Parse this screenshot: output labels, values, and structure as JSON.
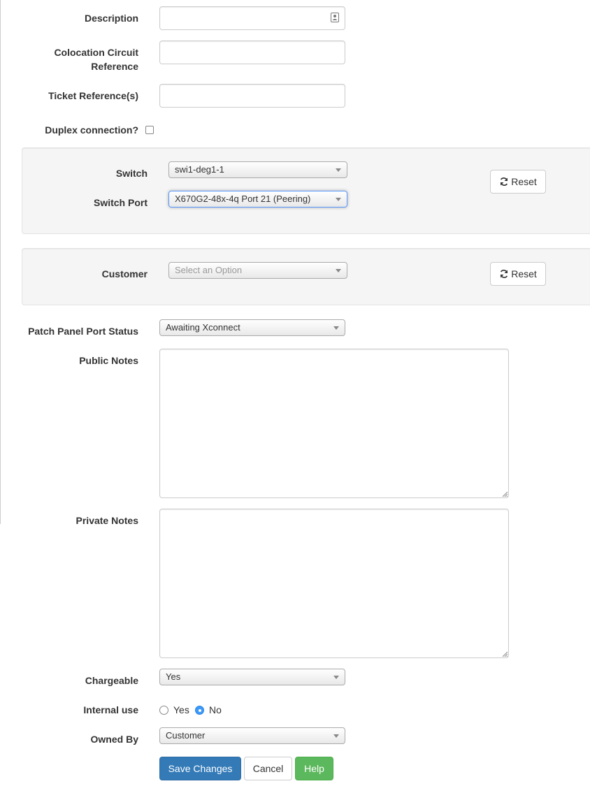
{
  "fields": {
    "description": {
      "label": "Description",
      "value": ""
    },
    "colocation": {
      "label_line1": "Colocation Circuit",
      "label_line2": "Reference",
      "value": ""
    },
    "ticket": {
      "label": "Ticket Reference(s)",
      "value": ""
    },
    "duplex": {
      "label": "Duplex connection?",
      "checked": false
    }
  },
  "switch_panel": {
    "switch_label": "Switch",
    "switch_value": "swi1-deg1-1",
    "port_label": "Switch Port",
    "port_value": "X670G2-48x-4q Port 21 (Peering)",
    "reset_label": "Reset"
  },
  "customer_panel": {
    "label": "Customer",
    "placeholder": "Select an Option",
    "reset_label": "Reset"
  },
  "status": {
    "label": "Patch Panel Port Status",
    "value": "Awaiting Xconnect"
  },
  "public_notes": {
    "label": "Public Notes",
    "value": ""
  },
  "private_notes": {
    "label": "Private Notes",
    "value": ""
  },
  "chargeable": {
    "label": "Chargeable",
    "value": "Yes"
  },
  "internal_use": {
    "label": "Internal use",
    "option_yes": "Yes",
    "option_no": "No",
    "selected": "No"
  },
  "owned_by": {
    "label": "Owned By",
    "value": "Customer"
  },
  "actions": {
    "save": "Save Changes",
    "cancel": "Cancel",
    "help": "Help"
  },
  "icons": {
    "reset": "refresh-icon",
    "description_field": "contact-card-icon",
    "select": "caret-down-icon"
  },
  "colors": {
    "primary": "#337ab7",
    "success": "#5cb85c",
    "radio_checked": "#3b99fc"
  }
}
